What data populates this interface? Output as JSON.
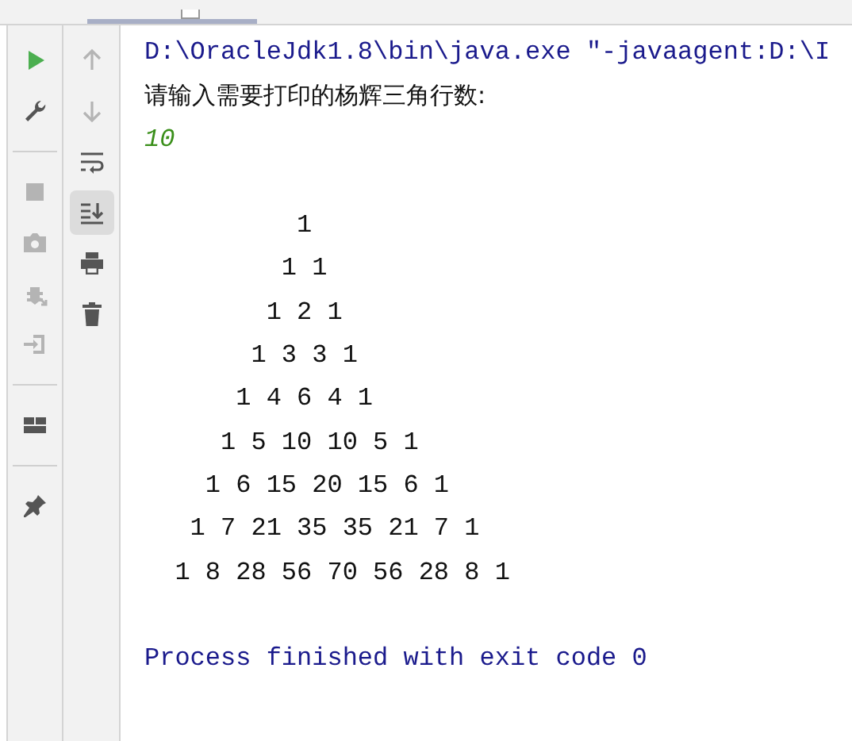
{
  "tab_strip": {
    "tabs": [
      {
        "selected": true
      }
    ]
  },
  "toolbar_left": [
    {
      "kind": "button",
      "disabled": false
    },
    {
      "kind": "button",
      "disabled": false
    },
    {
      "kind": "separator"
    },
    {
      "kind": "button",
      "disabled": true
    },
    {
      "kind": "button",
      "disabled": true
    },
    {
      "kind": "button",
      "disabled": true
    },
    {
      "kind": "button",
      "disabled": true
    },
    {
      "kind": "separator"
    },
    {
      "kind": "button",
      "disabled": false
    },
    {
      "kind": "separator"
    },
    {
      "kind": "button",
      "disabled": false
    }
  ],
  "toolbar_right": [
    {
      "kind": "button",
      "disabled": true,
      "selected": false
    },
    {
      "kind": "button",
      "disabled": true,
      "selected": false
    },
    {
      "kind": "button",
      "disabled": false,
      "selected": false
    },
    {
      "kind": "button",
      "disabled": false,
      "selected": true
    },
    {
      "kind": "button",
      "disabled": false,
      "selected": false
    },
    {
      "kind": "button",
      "disabled": false,
      "selected": false
    }
  ],
  "console": {
    "lines": [
      {
        "kind": "system",
        "text": "D:\\OracleJdk1.8\\bin\\java.exe \"-javaagent:D:\\I"
      },
      {
        "kind": "output",
        "text": "请输入需要打印的杨辉三角行数:"
      },
      {
        "kind": "input",
        "text": "10"
      },
      {
        "kind": "blank"
      },
      {
        "kind": "output",
        "text": "          1"
      },
      {
        "kind": "output",
        "text": "         1 1"
      },
      {
        "kind": "output",
        "text": "        1 2 1"
      },
      {
        "kind": "output",
        "text": "       1 3 3 1"
      },
      {
        "kind": "output",
        "text": "      1 4 6 4 1"
      },
      {
        "kind": "output",
        "text": "     1 5 10 10 5 1"
      },
      {
        "kind": "output",
        "text": "    1 6 15 20 15 6 1"
      },
      {
        "kind": "output",
        "text": "   1 7 21 35 35 21 7 1"
      },
      {
        "kind": "output",
        "text": "  1 8 28 56 70 56 28 8 1"
      },
      {
        "kind": "blank"
      },
      {
        "kind": "system",
        "text": "Process finished with exit code 0"
      }
    ]
  }
}
